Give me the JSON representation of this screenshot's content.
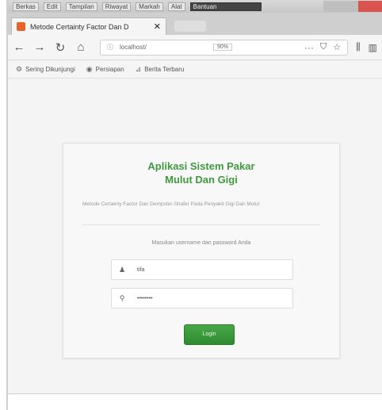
{
  "menubar": {
    "items": [
      "Berkas",
      "Edit",
      "Tampilan",
      "Riwayat",
      "Markah",
      "Alat",
      "Bantuan"
    ]
  },
  "tab": {
    "title": "Metode Certainty Factor Dan D",
    "close": "✕"
  },
  "nav": {
    "back": "←",
    "forward": "→",
    "reload": "↻",
    "home": "⌂",
    "url": "localhost/",
    "zoom": "90%",
    "more": "···",
    "pocket": "⛉",
    "star": "☆",
    "library": "⫼",
    "sidebar": "▥"
  },
  "bookmarks": [
    {
      "icon": "gear-icon",
      "glyph": "⚙",
      "label": "Sering Dikunjungi"
    },
    {
      "icon": "globe-icon",
      "glyph": "◉",
      "label": "Persiapan"
    },
    {
      "icon": "rss-icon",
      "glyph": "⊿",
      "label": "Berita Terbaru"
    }
  ],
  "card": {
    "title_line1": "Aplikasi Sistem Pakar",
    "title_line2": "Mulut Dan Gigi",
    "description": "Metode Certainty Factor Dan Dempster-Shafer Pada Penyakit Gigi Dan Mulut",
    "prompt": "Masukan username dan password Anda",
    "username_value": "tifa",
    "password_value": "••••••••",
    "login_label": "Login"
  },
  "colors": {
    "title_green": "#3f9a3f",
    "button_green": "#3a9a3a"
  }
}
